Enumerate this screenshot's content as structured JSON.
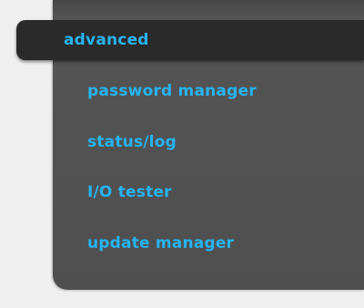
{
  "menu": {
    "active_label": "advanced",
    "items": [
      {
        "label": "password manager"
      },
      {
        "label": "status/log"
      },
      {
        "label": "I/O tester"
      },
      {
        "label": "update manager"
      }
    ]
  },
  "colors": {
    "link": "#27b4f0",
    "panel": "#555555",
    "active_background": "#2a2a2a",
    "page_background": "#efefef"
  }
}
